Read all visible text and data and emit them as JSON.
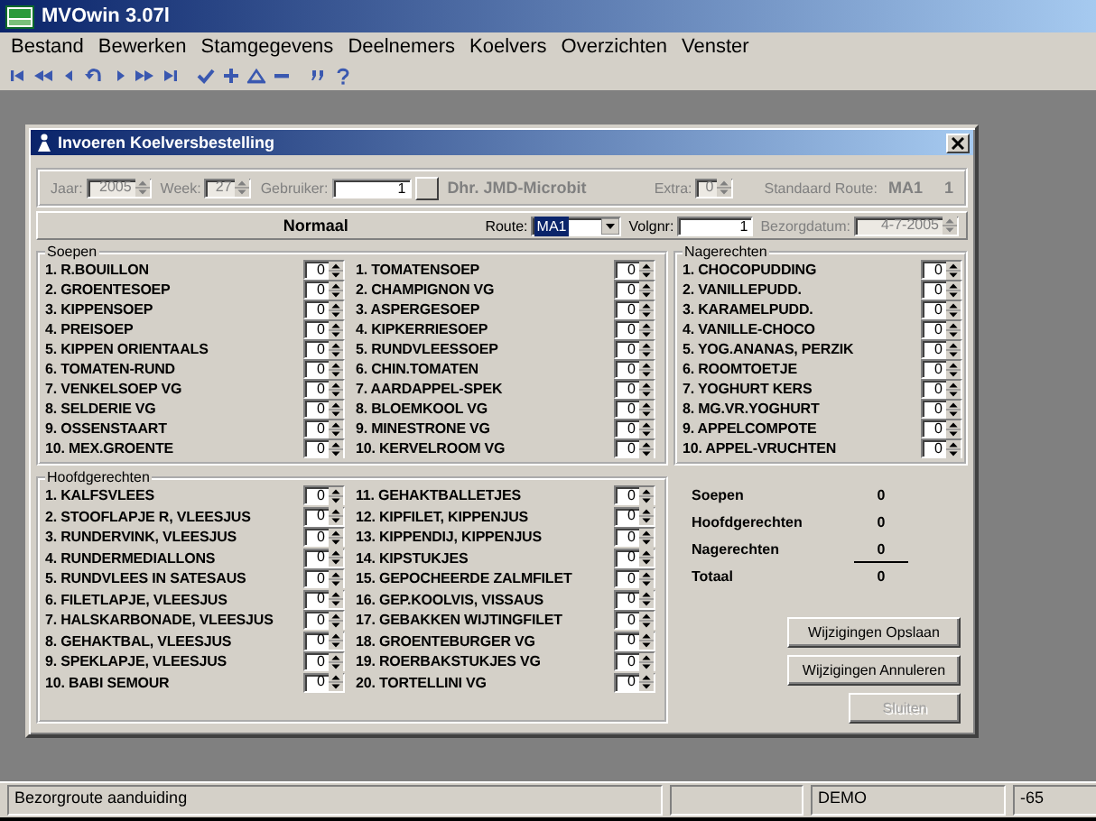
{
  "window": {
    "title": "MVOwin 3.07l"
  },
  "menu": [
    "Bestand",
    "Bewerken",
    "Stamgegevens",
    "Deelnemers",
    "Koelvers",
    "Overzichten",
    "Venster"
  ],
  "dialog": {
    "title": "Invoeren Koelversbestelling",
    "header": [
      {
        "kind": "spin",
        "label": "Jaar:",
        "value": "2005",
        "disabled": true
      },
      {
        "kind": "spin",
        "label": "Week:",
        "value": "27",
        "disabled": true
      },
      {
        "kind": "lookup",
        "label": "Gebruiker:",
        "value": "1",
        "disabled": true
      },
      {
        "kind": "name",
        "text": "Dhr. JMD-Microbit",
        "disabled": true
      },
      {
        "kind": "spin",
        "label": "Extra:",
        "value": "0",
        "disabled": true
      },
      {
        "kind": "route",
        "label": "Standaard Route:",
        "value": "MA1",
        "number": "1",
        "disabled": true
      }
    ],
    "route_bar": {
      "title": "Normaal",
      "fields": [
        {
          "kind": "combo",
          "label": "Route:",
          "value": "MA1",
          "highlighted": true,
          "disabled": false
        },
        {
          "kind": "text",
          "label": "Volgnr:",
          "value": "1",
          "disabled": false
        },
        {
          "kind": "spin",
          "label": "Bezorgdatum:",
          "value": "4-7-2005",
          "disabled": true
        }
      ]
    },
    "soepen": {
      "title": "Soepen",
      "items": [
        {
          "name": "1. R.BOUILLON",
          "quantity": "0"
        },
        {
          "name": "2. GROENTESOEP",
          "quantity": "0"
        },
        {
          "name": "3. KIPPENSOEP",
          "quantity": "0"
        },
        {
          "name": "4. PREISOEP",
          "quantity": "0"
        },
        {
          "name": "5. KIPPEN ORIENTAALS",
          "quantity": "0"
        },
        {
          "name": "6. TOMATEN-RUND",
          "quantity": "0"
        },
        {
          "name": "7. VENKELSOEP VG",
          "quantity": "0"
        },
        {
          "name": "8. SELDERIE VG",
          "quantity": "0"
        },
        {
          "name": "9. OSSENSTAART",
          "quantity": "0"
        },
        {
          "name": "10. MEX.GROENTE",
          "quantity": "0"
        },
        {
          "name": "1. TOMATENSOEP",
          "quantity": "0"
        },
        {
          "name": "2. CHAMPIGNON VG",
          "quantity": "0"
        },
        {
          "name": "3. ASPERGESOEP",
          "quantity": "0"
        },
        {
          "name": "4. KIPKERRIESOEP",
          "quantity": "0"
        },
        {
          "name": "5. RUNDVLEESSOEP",
          "quantity": "0"
        },
        {
          "name": "6. CHIN.TOMATEN",
          "quantity": "0"
        },
        {
          "name": "7. AARDAPPEL-SPEK",
          "quantity": "0"
        },
        {
          "name": "8. BLOEMKOOL VG",
          "quantity": "0"
        },
        {
          "name": "9. MINESTRONE VG",
          "quantity": "0"
        },
        {
          "name": "10. KERVELROOM VG",
          "quantity": "0"
        }
      ]
    },
    "nagerechten": {
      "title": "Nagerechten",
      "items": [
        {
          "name": "1. CHOCOPUDDING",
          "quantity": "0"
        },
        {
          "name": "2. VANILLEPUDD.",
          "quantity": "0"
        },
        {
          "name": "3. KARAMELPUDD.",
          "quantity": "0"
        },
        {
          "name": "4. VANILLE-CHOCO",
          "quantity": "0"
        },
        {
          "name": "5. YOG.ANANAS, PERZIK",
          "quantity": "0"
        },
        {
          "name": "6. ROOMTOETJE",
          "quantity": "0"
        },
        {
          "name": "7. YOGHURT KERS",
          "quantity": "0"
        },
        {
          "name": "8. MG.VR.YOGHURT",
          "quantity": "0"
        },
        {
          "name": "9. APPELCOMPOTE",
          "quantity": "0"
        },
        {
          "name": "10. APPEL-VRUCHTEN",
          "quantity": "0"
        }
      ]
    },
    "hoofdgerechten": {
      "title": "Hoofdgerechten",
      "items": [
        {
          "name": "1. KALFSVLEES",
          "quantity": "0"
        },
        {
          "name": "2. STOOFLAPJE R, VLEESJUS",
          "quantity": "0"
        },
        {
          "name": "3. RUNDERVINK, VLEESJUS",
          "quantity": "0"
        },
        {
          "name": "4. RUNDERMEDIALLONS",
          "quantity": "0"
        },
        {
          "name": "5. RUNDVLEES IN SATESAUS",
          "quantity": "0"
        },
        {
          "name": "6. FILETLAPJE, VLEESJUS",
          "quantity": "0"
        },
        {
          "name": "7. HALSKARBONADE, VLEESJUS",
          "quantity": "0"
        },
        {
          "name": "8. GEHAKTBAL, VLEESJUS",
          "quantity": "0"
        },
        {
          "name": "9. SPEKLAPJE, VLEESJUS",
          "quantity": "0"
        },
        {
          "name": "10. BABI SEMOUR",
          "quantity": "0"
        },
        {
          "name": "11. GEHAKTBALLETJES",
          "quantity": "0"
        },
        {
          "name": "12. KIPFILET, KIPPENJUS",
          "quantity": "0"
        },
        {
          "name": "13. KIPPENDIJ, KIPPENJUS",
          "quantity": "0"
        },
        {
          "name": "14. KIPSTUKJES",
          "quantity": "0"
        },
        {
          "name": "15. GEPOCHEERDE ZALMFILET",
          "quantity": "0"
        },
        {
          "name": "16. GEP.KOOLVIS, VISSAUS",
          "quantity": "0"
        },
        {
          "name": "17. GEBAKKEN WIJTINGFILET",
          "quantity": "0"
        },
        {
          "name": "18. GROENTEBURGER VG",
          "quantity": "0"
        },
        {
          "name": "19. ROERBAKSTUKJES VG",
          "quantity": "0"
        },
        {
          "name": "20. TORTELLINI VG",
          "quantity": "0"
        }
      ]
    },
    "totals": [
      {
        "label": "Soepen",
        "value": "0"
      },
      {
        "label": "Hoofdgerechten",
        "value": "0"
      },
      {
        "label": "Nagerechten",
        "value": "0"
      },
      {
        "label": "Totaal",
        "value": "0"
      }
    ],
    "buttons": [
      {
        "label": "Wijzigingen Opslaan",
        "disabled": false
      },
      {
        "label": "Wijzigingen Annuleren",
        "disabled": false
      },
      {
        "label": "Sluiten",
        "disabled": true
      }
    ]
  },
  "status_bar": {
    "panels": [
      {
        "kind": "text",
        "text": "Bezorgroute aanduiding"
      },
      {
        "kind": "blank"
      },
      {
        "kind": "text",
        "text": "DEMO"
      },
      {
        "kind": "text",
        "text": "-65"
      }
    ]
  }
}
